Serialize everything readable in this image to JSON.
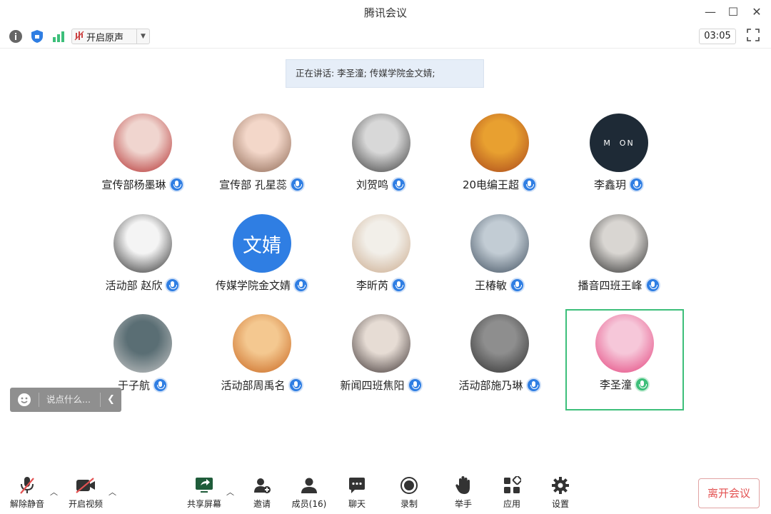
{
  "window": {
    "title": "腾讯会议"
  },
  "toolbar": {
    "original_sound_label": "开启原声",
    "timer": "03:05"
  },
  "speaking_banner": "正在讲话: 李圣潼; 传媒学院金文婧;",
  "participants": [
    {
      "name": "宣传部杨墨琳",
      "avatar": "photo"
    },
    {
      "name": "宣传部 孔星蕊",
      "avatar": "photo"
    },
    {
      "name": "刘贺鸣",
      "avatar": "photo"
    },
    {
      "name": "20电编王超",
      "avatar": "photo"
    },
    {
      "name": "李鑫玥",
      "avatar": "moon-logo",
      "avatar_text": "M  ON"
    },
    {
      "name": "活动部 赵欣",
      "avatar": "photo"
    },
    {
      "name": "传媒学院金文婧",
      "avatar": "text",
      "avatar_text": "文婧"
    },
    {
      "name": "李昕芮",
      "avatar": "photo"
    },
    {
      "name": "王椿敏",
      "avatar": "photo"
    },
    {
      "name": "播音四班王峰",
      "avatar": "photo"
    },
    {
      "name": "于子航",
      "avatar": "photo"
    },
    {
      "name": "活动部周禹名",
      "avatar": "photo"
    },
    {
      "name": "新闻四班焦阳",
      "avatar": "photo"
    },
    {
      "name": "活动部施乃琳",
      "avatar": "photo"
    },
    {
      "name": "李圣潼",
      "avatar": "photo",
      "speaking": true
    }
  ],
  "chat": {
    "placeholder": "说点什么..."
  },
  "bottom": {
    "unmute": "解除静音",
    "start_video": "开启视频",
    "share_screen": "共享屏幕",
    "invite": "邀请",
    "members": "成员(16)",
    "chat": "聊天",
    "record": "录制",
    "raise_hand": "举手",
    "apps": "应用",
    "settings": "设置",
    "leave": "离开会议"
  },
  "colors": {
    "accent_blue": "#2f7ee3",
    "speaking_green": "#3dbf7a",
    "leave_red": "#e35151"
  }
}
